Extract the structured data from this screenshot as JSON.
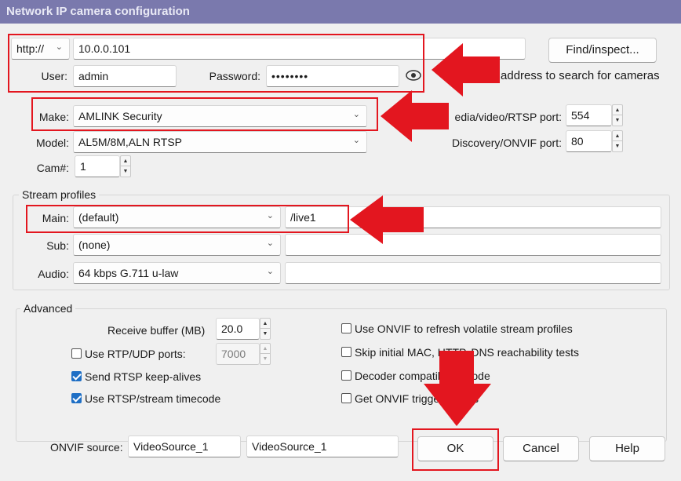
{
  "window": {
    "title": "Network IP camera configuration"
  },
  "connection": {
    "protocol": "http://",
    "address": "10.0.0.101",
    "find_button": "Find/inspect...",
    "user_label": "User:",
    "user_value": "admin",
    "password_label": "Password:",
    "password_value": "••••••••",
    "hint": "blank address to search for cameras"
  },
  "device": {
    "make_label": "Make:",
    "make_value": "AMLINK Security",
    "model_label": "Model:",
    "model_value": "AL5M/8M,ALN RTSP",
    "cam_label": "Cam#:",
    "cam_value": "1",
    "rtsp_port_label": "edia/video/RTSP port:",
    "rtsp_port_value": "554",
    "onvif_port_label": "Discovery/ONVIF port:",
    "onvif_port_value": "80"
  },
  "stream_profiles": {
    "title": "Stream profiles",
    "main_label": "Main:",
    "main_value": "(default)",
    "main_path": "/live1",
    "sub_label": "Sub:",
    "sub_value": "(none)",
    "sub_path": "",
    "audio_label": "Audio:",
    "audio_value": "64 kbps G.711 u-law",
    "audio_path": ""
  },
  "advanced": {
    "title": "Advanced",
    "receive_buffer_label": "Receive buffer (MB)",
    "receive_buffer_value": "20.0",
    "rtp_udp_label": "Use RTP/UDP ports:",
    "rtp_udp_checked": false,
    "rtp_udp_value": "7000",
    "keepalive_label": "Send RTSP keep-alives",
    "keepalive_checked": true,
    "timecode_label": "Use RTSP/stream timecode",
    "timecode_checked": true,
    "onvif_refresh_label": "Use ONVIF to refresh volatile stream profiles",
    "onvif_refresh_checked": false,
    "skip_tests_label": "Skip initial MAC, HTTP, DNS reachability tests",
    "skip_tests_checked": false,
    "decoder_label": "Decoder compatibility mode",
    "decoder_checked": false,
    "onvif_triggers_label": "Get ONVIF trigger events",
    "onvif_triggers_checked": false
  },
  "onvif_source": {
    "label": "ONVIF source:",
    "value1": "VideoSource_1",
    "value2": "VideoSource_1"
  },
  "buttons": {
    "ok": "OK",
    "cancel": "Cancel",
    "help": "Help"
  },
  "colors": {
    "title_bar": "#7a79ad",
    "annotation_red": "#e3161f",
    "checkbox_blue": "#1f6fc5"
  }
}
